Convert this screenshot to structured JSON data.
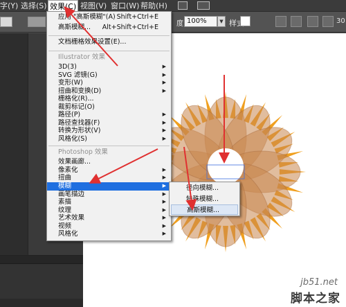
{
  "menubar": {
    "items": [
      "字(Y)",
      "选择(S)",
      "效果(C)",
      "视图(V)",
      "窗口(W)",
      "帮助(H)"
    ]
  },
  "ctrlbar": {
    "opacity_value": "100%",
    "opacity_label": "度",
    "style_label": "样式:",
    "right_partial": "30"
  },
  "effect_menu": {
    "apply_last": {
      "label": "应用 \"高斯模糊\"(A)",
      "shortcut": "Shift+Ctrl+E"
    },
    "last_effect": {
      "label": "高斯模糊...",
      "shortcut": "Alt+Shift+Ctrl+E"
    },
    "raster_settings": "文档栅格效果设置(E)...",
    "illustrator_header": "Illustrator 效果",
    "illustrator_items": [
      "3D(3)",
      "SVG 滤镜(G)",
      "变形(W)",
      "扭曲和变换(D)",
      "栅格化(R)...",
      "裁剪标记(O)",
      "路径(P)",
      "路径查找器(F)",
      "转换为形状(V)",
      "风格化(S)"
    ],
    "photoshop_header": "Photoshop 效果",
    "photoshop_items": [
      "效果画廊...",
      "像素化",
      "扭曲",
      "模糊",
      "画笔描边",
      "素描",
      "纹理",
      "艺术效果",
      "视频",
      "风格化"
    ]
  },
  "blur_submenu": {
    "items": [
      "径向模糊...",
      "特殊模糊...",
      "高斯模糊..."
    ]
  },
  "watermark": {
    "site": "jb51.net",
    "name": "脚本之家"
  },
  "colors": {
    "highlight": "#1f6fe0",
    "arrow_red": "#e03030",
    "petal": "#c8874e",
    "spike": "#f0a020"
  }
}
